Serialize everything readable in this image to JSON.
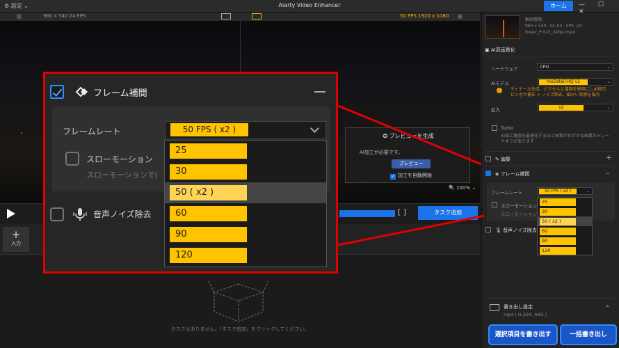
{
  "titlebar": {
    "settings": "設定",
    "title": "Aiarty Video Enhancer",
    "home": "ホーム",
    "win_controls": "—  ☐  ✕"
  },
  "preview_header": {
    "left_label": "前",
    "left_info": "960 x 540  24 FPS",
    "right_info": "50 FPS  1920 x 1080",
    "right_label": "後"
  },
  "preview_overlay": {
    "title": "プレビューを生成",
    "note": "AI加工が必要です。",
    "button": "プレビュー",
    "auto_start": "加工を自動開始",
    "zoom": "100%"
  },
  "controls": {
    "task_add": "タスク追加",
    "brackets": "[  ]"
  },
  "input": {
    "label": "入力"
  },
  "empty": {
    "message": "タスクはありません。「タスク追加」をクリックしてください。"
  },
  "side": {
    "source_info": [
      "動画情報:",
      "960 x 540 · 01:03 · FPS: 24",
      "tower_P-S-TI_24fps.mp4"
    ],
    "ai_section": "AI高画質化",
    "hardware_label": "ハードウェア",
    "hardware_value": "CPU",
    "ai_model_label": "AIモデル",
    "ai_model_value": "moDetail-HQ  v2",
    "ai_model_warn": "ディテール生成、ピクセルと階調を鮮明にしAI修正\nピンボケ補正 + ノイズ除去、細かい質感を描写",
    "scale_label": "拡大",
    "scale_value": "x2",
    "turbo_label": "Turbo",
    "turbo_desc": "AI加工速度を最適化するほど画質がわずかな画質のトレードオフがあります",
    "edit_label": "編集",
    "frame_interp_label": "フレーム補間",
    "frame_rate_label": "フレームレート",
    "frame_rate_value": "50 FPS ( x2 )",
    "slowmo_label": "スローモーション",
    "slowmo_desc": "スローモーションで",
    "noise_label": "音声ノイズ除去",
    "fps_options": [
      "25",
      "30",
      "50 ( x2 )",
      "60",
      "90",
      "120"
    ],
    "export_settings_label": "書き出し設定",
    "export_settings_value": "mp4 | H.264, AAC |",
    "export_selected": "選択項目を書き出す",
    "export_all": "一括書き出し"
  },
  "zoom_panel": {
    "title": "フレーム補間",
    "frame_rate_label": "フレームレート",
    "frame_rate_value": "50 FPS ( x2 )",
    "slowmo_label": "スローモーション",
    "slowmo_desc": "スローモーションで(",
    "noise_label": "音声ノイズ除去",
    "options": [
      "25",
      "30",
      "50 ( x2 )",
      "60",
      "90",
      "120"
    ]
  },
  "colors": {
    "accent": "#1a73e8",
    "option": "#ffc300",
    "callout": "#e00000"
  }
}
